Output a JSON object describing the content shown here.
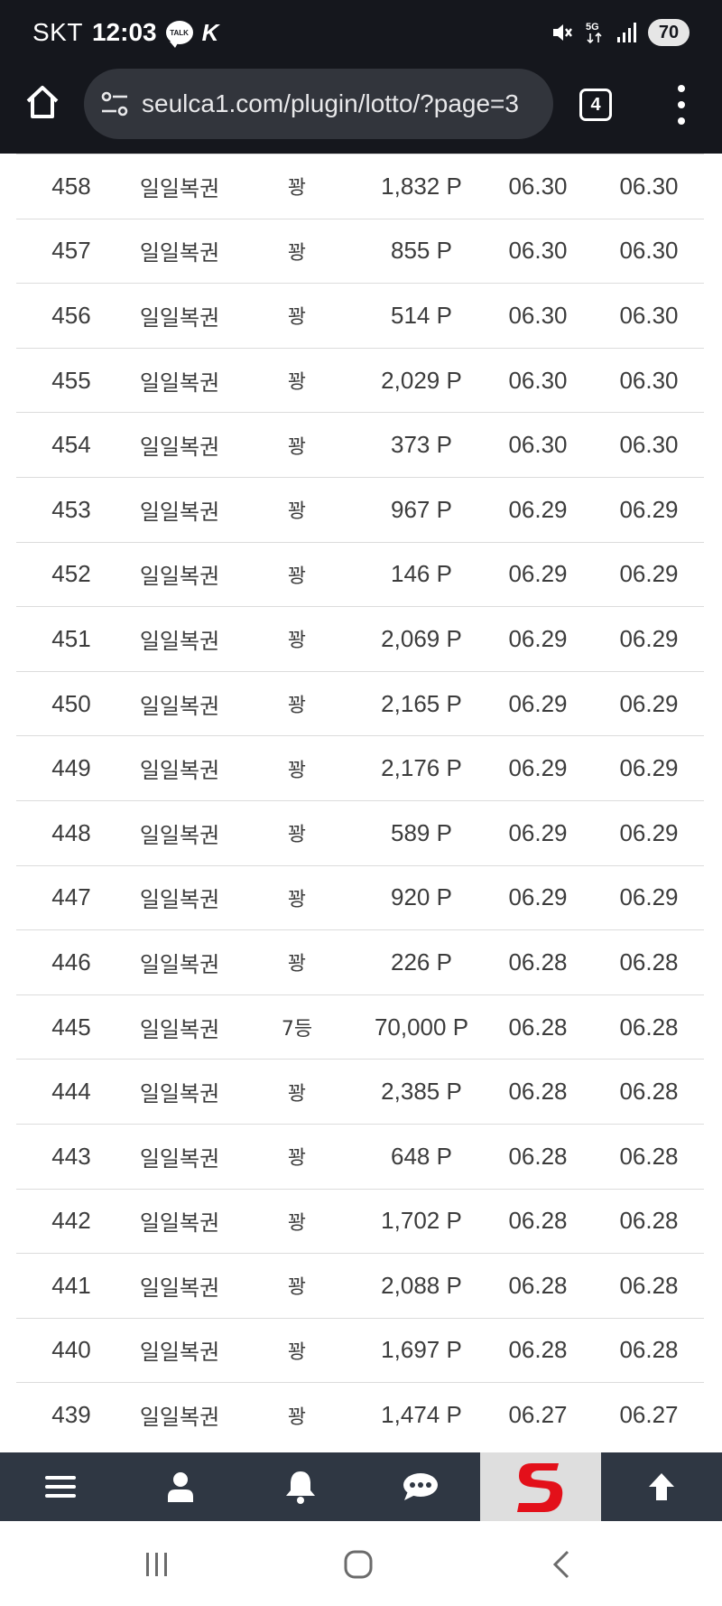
{
  "status_bar": {
    "carrier": "SKT",
    "time": "12:03",
    "talk_badge": "TALK",
    "network": "5G",
    "battery": "70"
  },
  "browser": {
    "url": "seulca1.com/plugin/lotto/?page=3",
    "tab_count": "4"
  },
  "table": {
    "rows": [
      {
        "no": "458",
        "name": "일일복권",
        "rank": "꽝",
        "point": "1,832 P",
        "date1": "06.30",
        "date2": "06.30"
      },
      {
        "no": "457",
        "name": "일일복권",
        "rank": "꽝",
        "point": "855 P",
        "date1": "06.30",
        "date2": "06.30"
      },
      {
        "no": "456",
        "name": "일일복권",
        "rank": "꽝",
        "point": "514 P",
        "date1": "06.30",
        "date2": "06.30"
      },
      {
        "no": "455",
        "name": "일일복권",
        "rank": "꽝",
        "point": "2,029 P",
        "date1": "06.30",
        "date2": "06.30"
      },
      {
        "no": "454",
        "name": "일일복권",
        "rank": "꽝",
        "point": "373 P",
        "date1": "06.30",
        "date2": "06.30"
      },
      {
        "no": "453",
        "name": "일일복권",
        "rank": "꽝",
        "point": "967 P",
        "date1": "06.29",
        "date2": "06.29"
      },
      {
        "no": "452",
        "name": "일일복권",
        "rank": "꽝",
        "point": "146 P",
        "date1": "06.29",
        "date2": "06.29"
      },
      {
        "no": "451",
        "name": "일일복권",
        "rank": "꽝",
        "point": "2,069 P",
        "date1": "06.29",
        "date2": "06.29"
      },
      {
        "no": "450",
        "name": "일일복권",
        "rank": "꽝",
        "point": "2,165 P",
        "date1": "06.29",
        "date2": "06.29"
      },
      {
        "no": "449",
        "name": "일일복권",
        "rank": "꽝",
        "point": "2,176 P",
        "date1": "06.29",
        "date2": "06.29"
      },
      {
        "no": "448",
        "name": "일일복권",
        "rank": "꽝",
        "point": "589 P",
        "date1": "06.29",
        "date2": "06.29"
      },
      {
        "no": "447",
        "name": "일일복권",
        "rank": "꽝",
        "point": "920 P",
        "date1": "06.29",
        "date2": "06.29"
      },
      {
        "no": "446",
        "name": "일일복권",
        "rank": "꽝",
        "point": "226 P",
        "date1": "06.28",
        "date2": "06.28"
      },
      {
        "no": "445",
        "name": "일일복권",
        "rank": "7등",
        "point": "70,000 P",
        "date1": "06.28",
        "date2": "06.28"
      },
      {
        "no": "444",
        "name": "일일복권",
        "rank": "꽝",
        "point": "2,385 P",
        "date1": "06.28",
        "date2": "06.28"
      },
      {
        "no": "443",
        "name": "일일복권",
        "rank": "꽝",
        "point": "648 P",
        "date1": "06.28",
        "date2": "06.28"
      },
      {
        "no": "442",
        "name": "일일복권",
        "rank": "꽝",
        "point": "1,702 P",
        "date1": "06.28",
        "date2": "06.28"
      },
      {
        "no": "441",
        "name": "일일복권",
        "rank": "꽝",
        "point": "2,088 P",
        "date1": "06.28",
        "date2": "06.28"
      },
      {
        "no": "440",
        "name": "일일복권",
        "rank": "꽝",
        "point": "1,697 P",
        "date1": "06.28",
        "date2": "06.28"
      },
      {
        "no": "439",
        "name": "일일복권",
        "rank": "꽝",
        "point": "1,474 P",
        "date1": "06.27",
        "date2": "06.27"
      }
    ]
  },
  "bottom_nav": {
    "items": [
      "menu-icon",
      "user-icon",
      "bell-icon",
      "chat-icon",
      "site-logo",
      "arrow-up-icon"
    ]
  },
  "colors": {
    "top_bar_bg": "#15171d",
    "url_pill_bg": "#32353c",
    "nav_bg": "#2f3743",
    "logo_red": "#e3101a"
  }
}
